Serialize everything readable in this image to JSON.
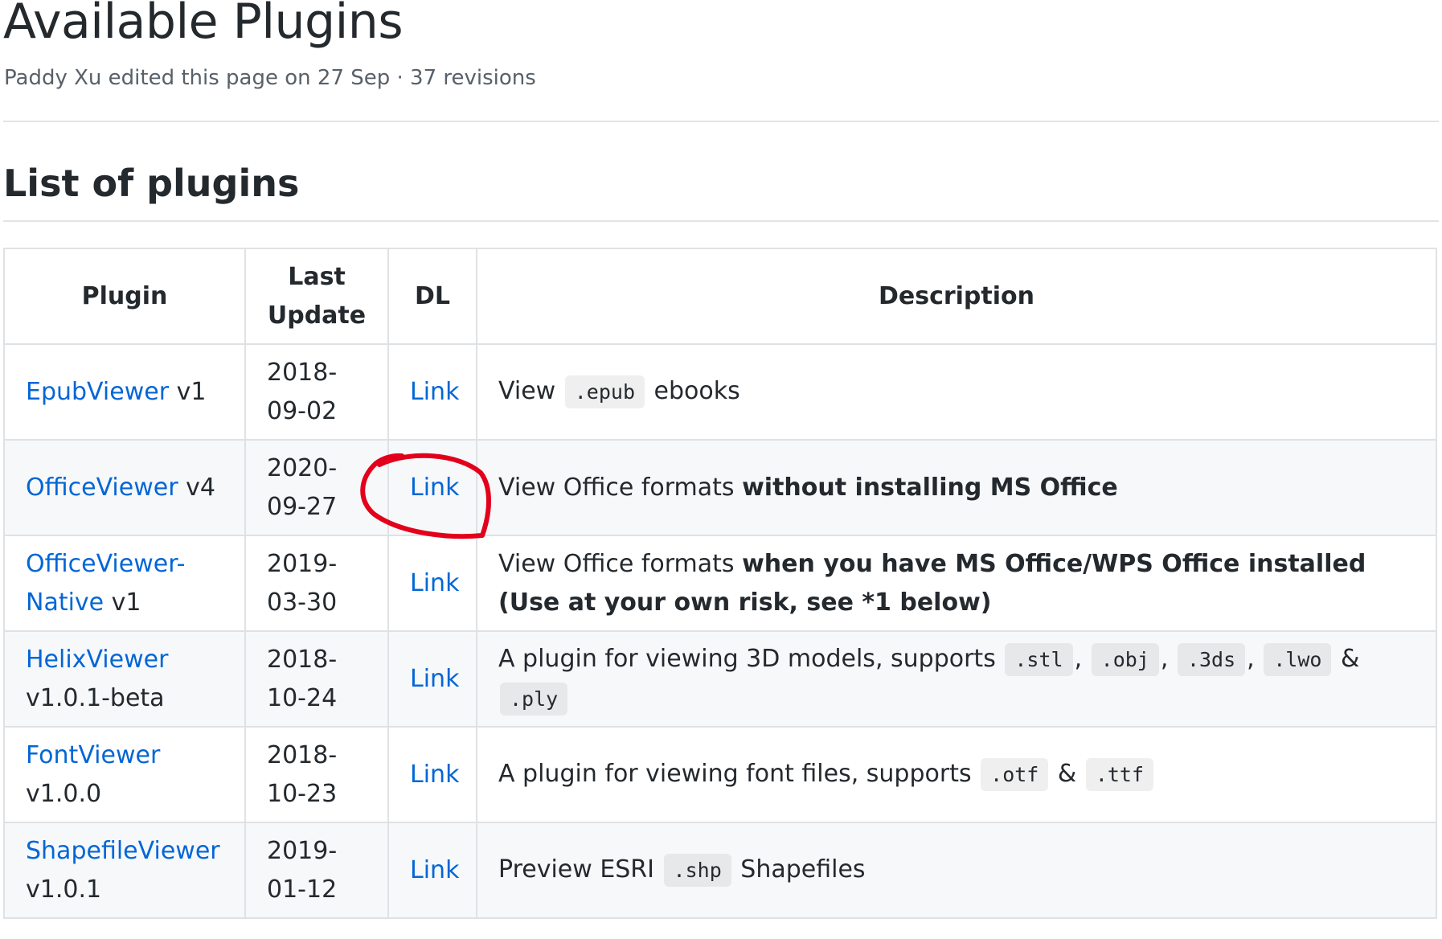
{
  "page": {
    "title": "Available Plugins",
    "meta": "Paddy Xu edited this page on 27 Sep · 37 revisions"
  },
  "section": {
    "heading": "List of plugins"
  },
  "table": {
    "headers": {
      "plugin": "Plugin",
      "update_line1": "Last",
      "update_line2": "Update",
      "dl": "DL",
      "description": "Description"
    },
    "rows": [
      {
        "name": "EpubViewer",
        "version": " v1",
        "date1": "2018-",
        "date2": "09-02",
        "dl": "Link",
        "d1": "View ",
        "c1": ".epub",
        "d2": " ebooks"
      },
      {
        "name": "OfficeViewer",
        "version": " v4",
        "date1": "2020-",
        "date2": "09-27",
        "dl": "Link",
        "d1": "View Office formats ",
        "b1": "without installing MS Office"
      },
      {
        "name": "OfficeViewer-Native",
        "version": " v1",
        "date1": "2019-",
        "date2": "03-30",
        "dl": "Link",
        "d1": "View Office formats ",
        "b1": "when you have MS Office/WPS Office installed (Use at your own risk, see *1 below)"
      },
      {
        "name": "HelixViewer",
        "version": "v1.0.1-beta",
        "date1": "2018-",
        "date2": "10-24",
        "dl": "Link",
        "d1": "A plugin for viewing 3D models, supports ",
        "c1": ".stl",
        "s1": ", ",
        "c2": ".obj",
        "s2": ", ",
        "c3": ".3ds",
        "s3": ", ",
        "c4": ".lwo",
        "s4": " & ",
        "c5": ".ply"
      },
      {
        "name": "FontViewer",
        "version": "v1.0.0",
        "date1": "2018-",
        "date2": "10-23",
        "dl": "Link",
        "d1": "A plugin for viewing font files, supports ",
        "c1": ".otf",
        "s1": " & ",
        "c2": ".ttf"
      },
      {
        "name": "ShapefileViewer",
        "version": "v1.0.1",
        "date1": "2019-",
        "date2": "01-12",
        "dl": "Link",
        "d1": "Preview ESRI ",
        "c1": ".shp",
        "d2": " Shapefiles"
      }
    ]
  },
  "colors": {
    "link": "#0366d6",
    "text": "#24292e",
    "muted": "#586069",
    "border": "#dfe2e5",
    "alt_row": "#f6f8fa",
    "annotation": "#e3001b"
  }
}
